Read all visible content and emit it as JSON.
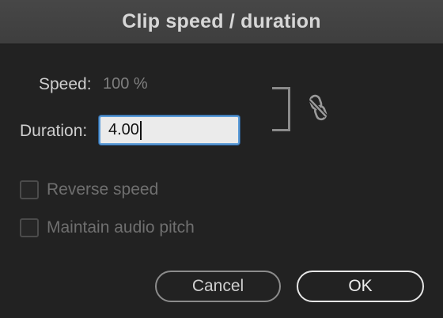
{
  "dialog": {
    "title": "Clip speed / duration"
  },
  "speed": {
    "label": "Speed:",
    "value": "100 %"
  },
  "duration": {
    "label": "Duration:",
    "value": "4.00"
  },
  "link": {
    "icon": "unlink-chain-icon",
    "state": "unlinked"
  },
  "options": [
    {
      "label": "Reverse speed",
      "checked": false,
      "enabled": false
    },
    {
      "label": "Maintain audio pitch",
      "checked": false,
      "enabled": false
    }
  ],
  "buttons": {
    "cancel_label": "Cancel",
    "ok_label": "OK"
  },
  "colors": {
    "background": "#222222",
    "titlebar": "#424242",
    "focus_ring": "#5a9bd8"
  }
}
